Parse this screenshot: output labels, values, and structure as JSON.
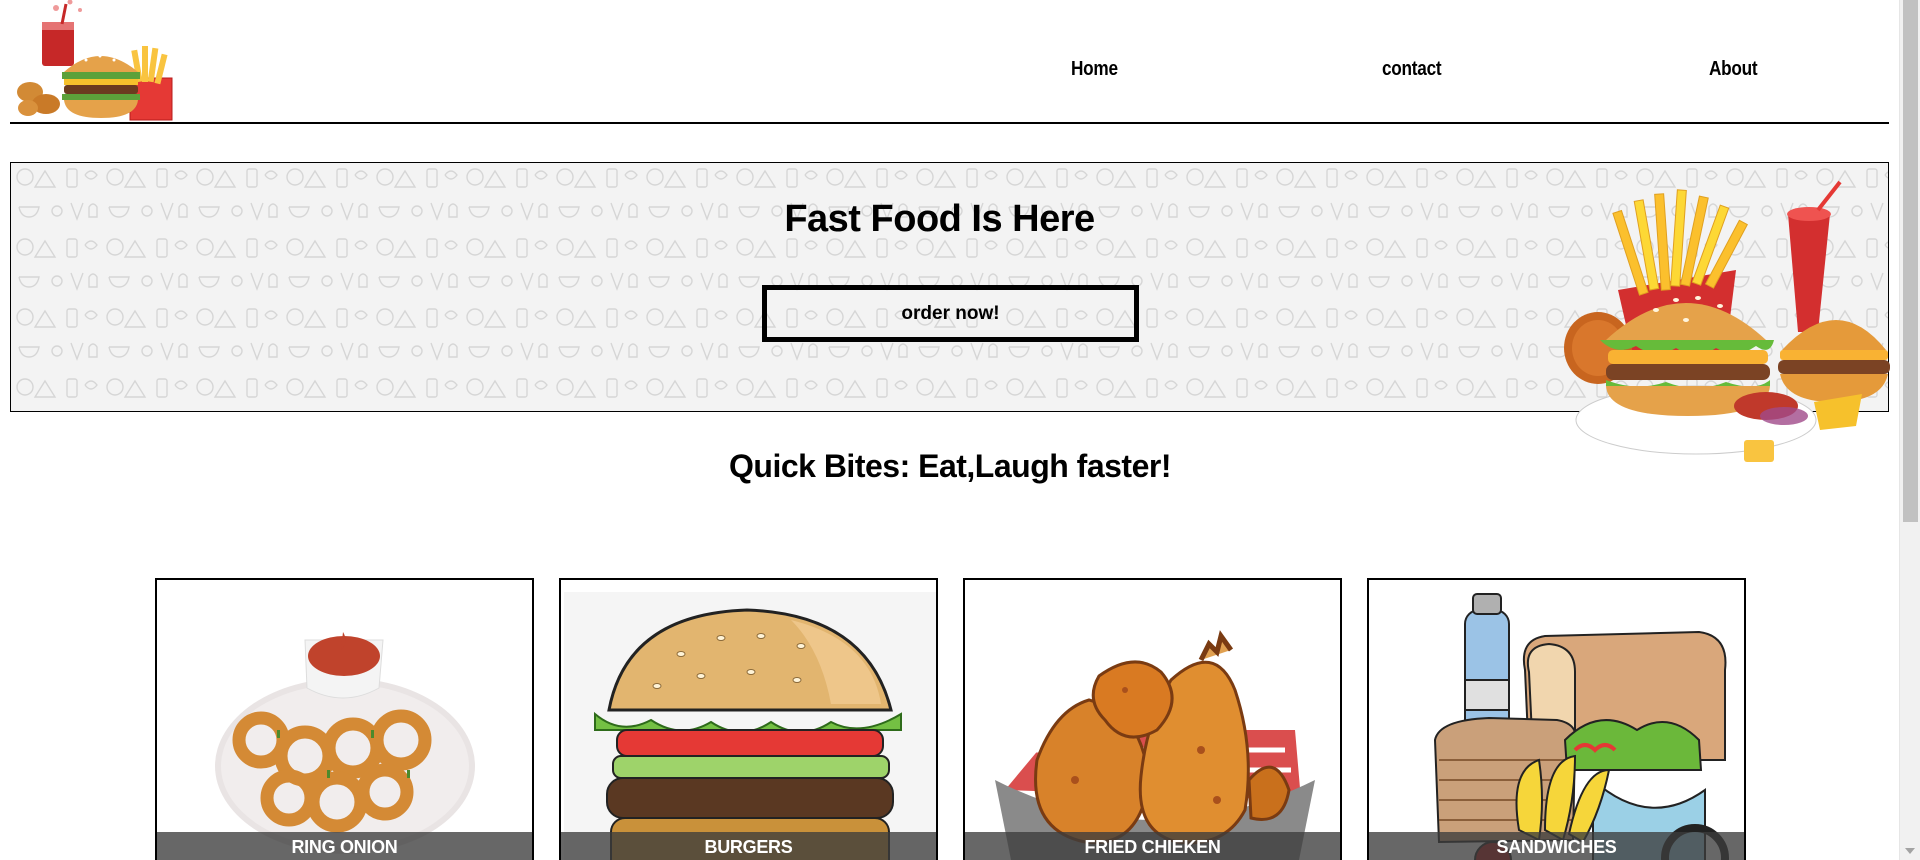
{
  "nav": {
    "links": [
      {
        "label": "Home"
      },
      {
        "label": "contact"
      },
      {
        "label": "About"
      }
    ]
  },
  "hero": {
    "title": "Fast Food Is Here",
    "button_label": "order now!"
  },
  "tagline": "Quick Bites: Eat,Laugh faster!",
  "cards": [
    {
      "label": "RING ONION",
      "icon": "onion-rings-image"
    },
    {
      "label": "BURGERS",
      "icon": "burger-image"
    },
    {
      "label": "FRIED CHIEKEN",
      "icon": "fried-chicken-image"
    },
    {
      "label": "SANDWICHES",
      "icon": "sandwiches-image"
    }
  ],
  "colors": {
    "text": "#000000",
    "card_label_bg": "#3c3c3c",
    "hero_bg": "#f3f3f3"
  }
}
